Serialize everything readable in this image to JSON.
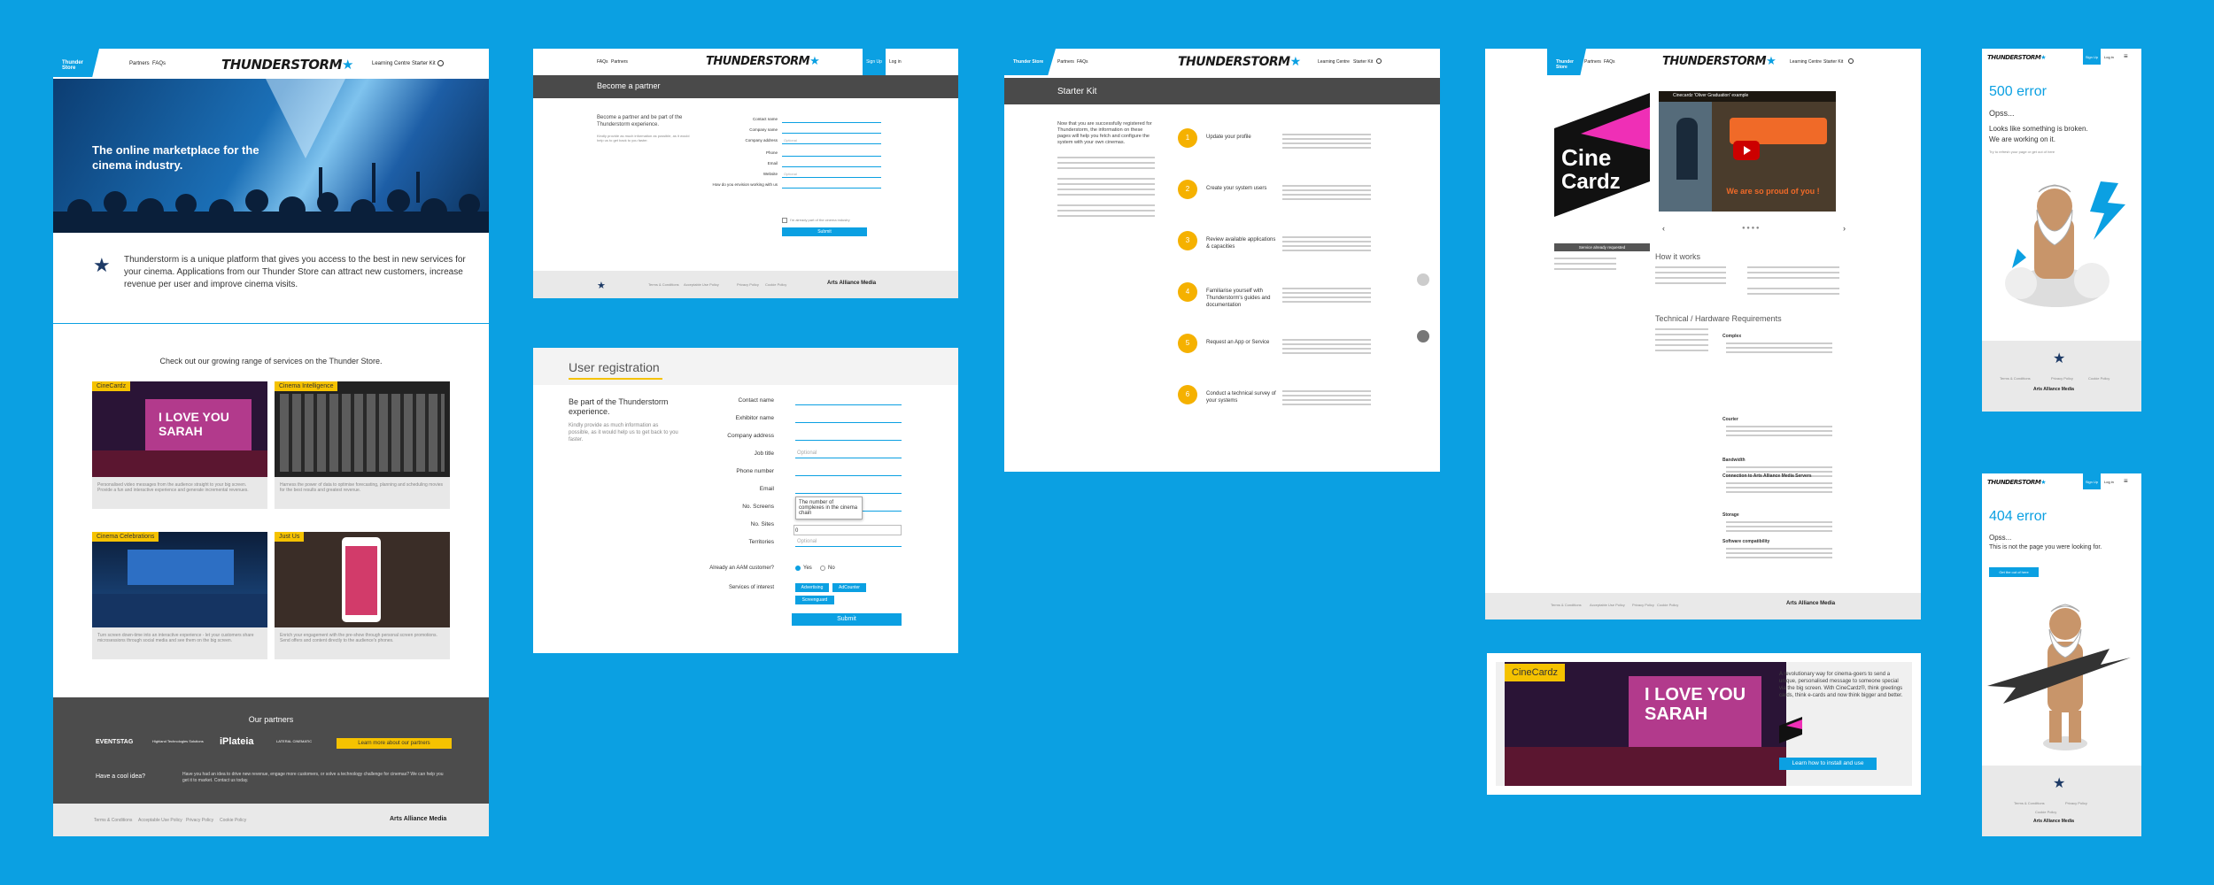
{
  "brand": {
    "logo": "THUNDERSTORM",
    "accent": "#0ba0e2",
    "yellow": "#f5c200",
    "dark": "#4a4a4a"
  },
  "nav": {
    "thunder_store": "Thunder Store",
    "partners": "Partners",
    "faqs": "FAQs",
    "learning_centre": "Learning Centre",
    "starter_kit": "Starter Kit",
    "sign_up": "Sign Up",
    "log_in": "Log in"
  },
  "home": {
    "hero_title": "The online marketplace for the cinema industry.",
    "intro": "Thunderstorm is a unique platform that gives you access to the best in new services for your cinema. Applications from our Thunder Store can attract new customers, increase revenue per user and improve cinema visits.",
    "services_heading": "Check out our growing range of services on the Thunder Store.",
    "services": [
      {
        "tag": "CineCardz",
        "desc": "Personalised video messages from the audience straight to your big screen. Provide a fun and interactive experience and generate incremental revenues."
      },
      {
        "tag": "Cinema Intelligence",
        "desc": "Harness the power of data to optimise forecasting, planning and scheduling movies for the best results and greatest revenue."
      },
      {
        "tag": "Cinema Celebrations",
        "desc": "Turn screen down-time into an interactive experience - let your customers share microsessions through social media and see them on the big screen."
      },
      {
        "tag": "Just Us",
        "desc": "Enrich your engagement with the pre-show through personal screen promotions. Send offers and content directly to the audience's phones."
      }
    ],
    "partners_title": "Our partners",
    "partners": [
      "EVENTSTAG",
      "Highland Technologies Solutions",
      "iPlateia",
      "LATERAL CINEMATIC"
    ],
    "partners_cta": "Learn more about our partners",
    "idea_title": "Have a cool idea?",
    "idea_text": "Have you had an idea to drive new revenue, engage more customers, or solve a technology challenge for cinemas? We can help you get it to market. Contact us today."
  },
  "footer": {
    "links": [
      "Terms & Conditions",
      "Acceptable Use Policy",
      "Privacy Policy",
      "Cookie Policy"
    ],
    "aam": "Arts Alliance Media"
  },
  "partner_page": {
    "title": "Become a partner",
    "lead": "Become a partner and be part of the Thunderstorm experience.",
    "sub": "Kindly provide as much information as possible, as it would help us to get back to you faster.",
    "fields": [
      "Contact name",
      "Company name",
      "Company address",
      "Phone",
      "Email",
      "Website",
      "How do you envision working with us"
    ],
    "placeholders": [
      "Optional",
      "Optional"
    ],
    "checkbox": "I'm already part of the cinema industry",
    "submit": "Submit"
  },
  "registration": {
    "title": "User registration",
    "lead": "Be part of the Thunderstorm experience.",
    "sub": "Kindly provide as much information as possible, as it would help us to get back to you faster.",
    "fields": [
      "Contact name",
      "Exhibitor name",
      "Company address",
      "Job title",
      "Phone number",
      "Email",
      "No. Screens",
      "No. Sites",
      "Territories"
    ],
    "optional": "Optional",
    "tooltip": "The number of complexes in the cinema chain",
    "sites_value": "0",
    "aam_question": "Already an AAM customer?",
    "yes": "Yes",
    "no": "No",
    "services_label": "Services of interest",
    "chips": [
      "Advertising",
      "AdCounter",
      "Screenguard"
    ],
    "submit": "Submit"
  },
  "starter": {
    "title": "Starter Kit",
    "intro": "Now that you are successfully registered for Thunderstorm, the information on these pages will help you fetch and configure the system with your own cinemas.",
    "steps": [
      {
        "n": "1",
        "t": "Update your profile"
      },
      {
        "n": "2",
        "t": "Create your system users"
      },
      {
        "n": "3",
        "t": "Review available applications & capacities"
      },
      {
        "n": "4",
        "t": "Familiarise yourself with Thunderstorm's guides and documentation"
      },
      {
        "n": "5",
        "t": "Request an App or Service"
      },
      {
        "n": "6",
        "t": "Conduct a technical survey of your systems"
      }
    ]
  },
  "cinecardz_page": {
    "video_title": "Cinecardz 'Oliver Graduation' example",
    "video_caption": "We are so proud of you !",
    "banner": "Service already requested",
    "how_title": "How it works",
    "tech_title": "Technical / Hardware Requirements",
    "req_groups": [
      "Complex",
      "Courier",
      "Bandwidth",
      "Connection to Arts Alliance Media Servers",
      "Storage",
      "Software compatibility"
    ]
  },
  "cinecardz_card": {
    "tag": "CineCardz",
    "desc": "A revolutionary way for cinema-goers to send a unique, personalised message to someone special via the big screen. With CineCardz®, think greetings cards, think e-cards and now think bigger and better.",
    "cta": "Learn how to install and use",
    "screen_text_1": "I LOVE YOU",
    "screen_text_2": "SARAH"
  },
  "errors": [
    {
      "code": "500 error",
      "line1": "Opss...",
      "line2": "Looks like something is broken.",
      "line3": "We are working on it.",
      "link": "Try to refresh your page or get out of here"
    },
    {
      "code": "404 error",
      "line1": "Opss...",
      "line2": "This is not the page you were looking for.",
      "btn": "Get the out of here"
    }
  ]
}
